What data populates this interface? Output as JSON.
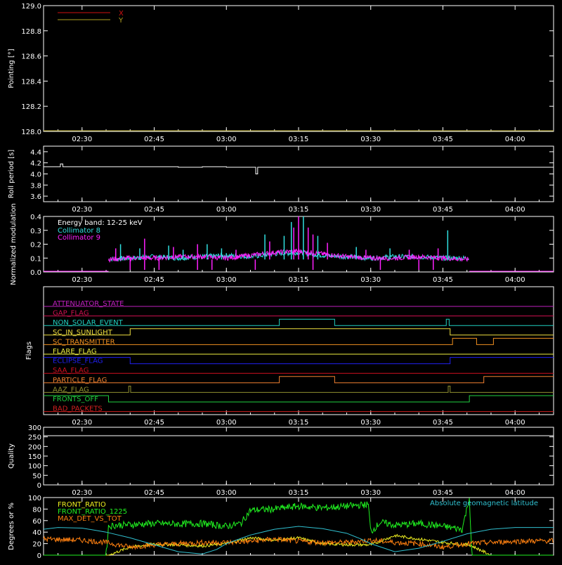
{
  "x_axis": {
    "ticks": [
      "02:30",
      "02:45",
      "03:00",
      "03:15",
      "03:30",
      "03:45",
      "04:00"
    ],
    "tick_minutes": [
      150,
      165,
      180,
      195,
      210,
      225,
      240
    ],
    "range_minutes": [
      142,
      248
    ]
  },
  "chart_data": [
    {
      "type": "line",
      "title": "",
      "ylabel": "Pointing [°]",
      "ylim": [
        128.0,
        129.0
      ],
      "yticks": [
        "128.0",
        "128.2",
        "128.4",
        "128.6",
        "128.8",
        "129.0"
      ],
      "ytick_values": [
        128.0,
        128.2,
        128.4,
        128.6,
        128.8,
        129.0
      ],
      "legend": {
        "placement": "top-left",
        "entries": [
          {
            "name": "X",
            "color": "#d01010"
          },
          {
            "name": "Y",
            "color": "#b0a020"
          }
        ]
      },
      "series": [
        {
          "name": "X",
          "color": "#d01010",
          "x": [
            142,
            248
          ],
          "y": [
            128.0,
            128.0
          ]
        },
        {
          "name": "Y",
          "color": "#b0a020",
          "x": [
            142,
            248
          ],
          "y": [
            128.0,
            128.0
          ]
        }
      ]
    },
    {
      "type": "line",
      "ylabel": "Roll period [s]",
      "ylim": [
        3.5,
        4.5
      ],
      "yticks": [
        "3.6",
        "3.8",
        "4.0",
        "4.2",
        "4.4"
      ],
      "ytick_values": [
        3.6,
        3.8,
        4.0,
        4.2,
        4.4
      ],
      "series": [
        {
          "name": "",
          "color": "#ffffff",
          "x": [
            142,
            145,
            145.5,
            146,
            150,
            160,
            170,
            175,
            180,
            185,
            186,
            186.1,
            186.4,
            186.5,
            190,
            200,
            210,
            220,
            225,
            230,
            240,
            248
          ],
          "y": [
            4.13,
            4.13,
            4.18,
            4.13,
            4.13,
            4.13,
            4.12,
            4.13,
            4.12,
            4.12,
            4.12,
            4.0,
            4.0,
            4.12,
            4.12,
            4.12,
            4.12,
            4.12,
            4.12,
            4.12,
            4.12,
            4.12
          ]
        }
      ]
    },
    {
      "type": "line",
      "ylabel": "Normalized modulation",
      "ylim": [
        0.0,
        0.4
      ],
      "yticks": [
        "0.0",
        "0.1",
        "0.2",
        "0.3",
        "0.4"
      ],
      "ytick_values": [
        0.0,
        0.1,
        0.2,
        0.3,
        0.4
      ],
      "annotation": "Energy band: 12-25 keV",
      "legend": {
        "placement": "top-left",
        "entries": [
          {
            "name": "Collimator 8",
            "color": "#30e0e0"
          },
          {
            "name": "Collimator 9",
            "color": "#ff20ff"
          }
        ]
      },
      "active_range": [
        155.5,
        230.5
      ],
      "series": [
        {
          "name": "Collimator 8",
          "color": "#30e0e0",
          "x": [
            155.5,
            160,
            165,
            170,
            175,
            180,
            185,
            190,
            195,
            200,
            205,
            210,
            215,
            220,
            225,
            230.5
          ],
          "y": [
            0.09,
            0.1,
            0.11,
            0.1,
            0.11,
            0.12,
            0.11,
            0.13,
            0.14,
            0.12,
            0.11,
            0.1,
            0.11,
            0.11,
            0.1,
            0.1
          ]
        },
        {
          "name": "Collimator 9",
          "color": "#ff20ff",
          "x": [
            155.5,
            160,
            165,
            170,
            175,
            180,
            185,
            190,
            195,
            200,
            205,
            210,
            215,
            220,
            225,
            230.5
          ],
          "y": [
            0.09,
            0.1,
            0.1,
            0.11,
            0.11,
            0.1,
            0.12,
            0.14,
            0.15,
            0.13,
            0.11,
            0.1,
            0.1,
            0.11,
            0.1,
            0.09
          ]
        }
      ],
      "spikes": [
        {
          "name": "Collimator 8",
          "x": [
            158,
            162,
            168,
            171,
            176,
            179,
            188,
            192,
            193.5,
            196,
            199,
            207,
            214,
            226
          ],
          "y": [
            0.2,
            0.17,
            0.19,
            0.16,
            0.2,
            0.17,
            0.27,
            0.26,
            0.36,
            0.4,
            0.26,
            0.18,
            0.17,
            0.3
          ]
        },
        {
          "name": "Collimator 9",
          "x": [
            157,
            163,
            169,
            174,
            182,
            189,
            194,
            195,
            197,
            198,
            201,
            209,
            218,
            224
          ],
          "y": [
            0.17,
            0.24,
            0.18,
            0.2,
            0.16,
            0.22,
            0.32,
            0.4,
            0.32,
            0.27,
            0.21,
            0.16,
            0.16,
            0.17
          ]
        }
      ]
    },
    {
      "type": "line",
      "ylabel": "Flags",
      "flags": [
        {
          "name": "ATTENUATOR_STATE",
          "color": "#c020c0",
          "changes": [],
          "values": []
        },
        {
          "name": "GAP_FLAG",
          "color": "#d01050",
          "changes": [],
          "values": []
        },
        {
          "name": "NON_SOLAR_EVENT",
          "color": "#20d0c0",
          "changes": [
            191,
            202.5,
            225.7,
            226.3
          ],
          "values": [
            0,
            1,
            0,
            1,
            0
          ]
        },
        {
          "name": "SC_IN_SUNLIGHT",
          "color": "#f0e040",
          "changes": [
            160,
            226.5
          ],
          "values": [
            0,
            1,
            0
          ]
        },
        {
          "name": "SC_TRANSMITTER",
          "color": "#f09020",
          "changes": [
            227,
            232,
            235.5
          ],
          "values": [
            0,
            1,
            0,
            1
          ]
        },
        {
          "name": "FLARE_FLAG",
          "color": "#f0f040",
          "changes": [],
          "values": []
        },
        {
          "name": "ECLIPSE_FLAG",
          "color": "#2020f0",
          "changes": [
            160,
            226.5
          ],
          "values": [
            1,
            0,
            1
          ]
        },
        {
          "name": "SAA_FLAG",
          "color": "#d01020",
          "changes": [],
          "values": []
        },
        {
          "name": "PARTICLE_FLAG",
          "color": "#f08030",
          "changes": [
            191,
            202.5,
            233.5
          ],
          "values": [
            0,
            1,
            0,
            1
          ]
        },
        {
          "name": "AAZ_FLAG",
          "color": "#909030",
          "changes": [
            159.7,
            160.1,
            226.1,
            226.5
          ],
          "values": [
            0,
            1,
            0,
            1,
            0
          ]
        },
        {
          "name": "FRONTS_OFF",
          "color": "#20d040",
          "changes": [
            155.5,
            230.5
          ],
          "values": [
            1,
            0,
            1
          ]
        },
        {
          "name": "BAD_PACKETS",
          "color": "#d02020",
          "changes": [],
          "values": []
        }
      ]
    },
    {
      "type": "line",
      "ylabel": "Quality",
      "ylim": [
        0,
        300
      ],
      "yticks": [
        "0",
        "50",
        "100",
        "150",
        "200",
        "250",
        "300"
      ],
      "ytick_values": [
        0,
        50,
        100,
        150,
        200,
        250,
        300
      ],
      "series": []
    },
    {
      "type": "line",
      "ylabel": "Degrees or %",
      "ylim": [
        0,
        100
      ],
      "yticks": [
        "0",
        "20",
        "40",
        "60",
        "80",
        "100"
      ],
      "ytick_values": [
        0,
        20,
        40,
        60,
        80,
        100
      ],
      "annotation": "Absolute geomagnetic latitude",
      "legend": {
        "placement": "top-left",
        "entries": [
          {
            "name": "FRONT_RATIO",
            "color": "#f0f020"
          },
          {
            "name": "FRONT_RATIO_1225",
            "color": "#20f020"
          },
          {
            "name": "MAX_DET_VS_TOT",
            "color": "#ff8010"
          }
        ]
      },
      "series": [
        {
          "name": "FRONT_RATIO",
          "color": "#f0f020",
          "x": [
            142,
            150,
            155.5,
            160,
            165,
            170,
            175,
            180,
            185,
            190,
            195,
            200,
            205,
            210,
            215,
            220,
            225,
            230.5,
            235,
            240,
            248
          ],
          "y": [
            0,
            0,
            0,
            14,
            19,
            18,
            16,
            20,
            30,
            26,
            30,
            20,
            18,
            18,
            34,
            28,
            22,
            18,
            0,
            0,
            0
          ]
        },
        {
          "name": "FRONT_RATIO_1225",
          "color": "#20f020",
          "x": [
            142,
            155,
            155.5,
            157,
            160,
            165,
            170,
            175,
            180,
            183,
            185,
            190,
            195,
            200,
            205,
            209.5,
            210,
            212,
            215,
            220,
            225,
            229,
            230.5,
            231,
            248
          ],
          "y": [
            0,
            0,
            50,
            52,
            53,
            55,
            54,
            55,
            50,
            55,
            78,
            80,
            85,
            82,
            85,
            88,
            40,
            57,
            52,
            55,
            50,
            45,
            100,
            0,
            0
          ]
        },
        {
          "name": "MAX_DET_VS_TOT",
          "color": "#ff8010",
          "x": [
            142,
            150,
            155,
            160,
            165,
            170,
            175,
            180,
            185,
            190,
            195,
            200,
            205,
            210,
            215,
            220,
            225,
            230,
            235,
            240,
            248
          ],
          "y": [
            28,
            26,
            22,
            14,
            18,
            20,
            22,
            22,
            24,
            28,
            24,
            22,
            22,
            26,
            22,
            20,
            14,
            20,
            22,
            24,
            25
          ]
        },
        {
          "name": "Absolute geomagnetic latitude",
          "color": "#30c0d0",
          "x": [
            142,
            145,
            150,
            155,
            160,
            165,
            170,
            175,
            178,
            180,
            185,
            190,
            195,
            200,
            205,
            208,
            210,
            215,
            220,
            225,
            230,
            235,
            240,
            245,
            248
          ],
          "y": [
            45,
            48,
            47,
            40,
            30,
            18,
            6,
            2,
            10,
            20,
            35,
            45,
            50,
            46,
            38,
            28,
            20,
            6,
            12,
            24,
            37,
            45,
            48,
            48,
            48
          ]
        }
      ]
    }
  ]
}
